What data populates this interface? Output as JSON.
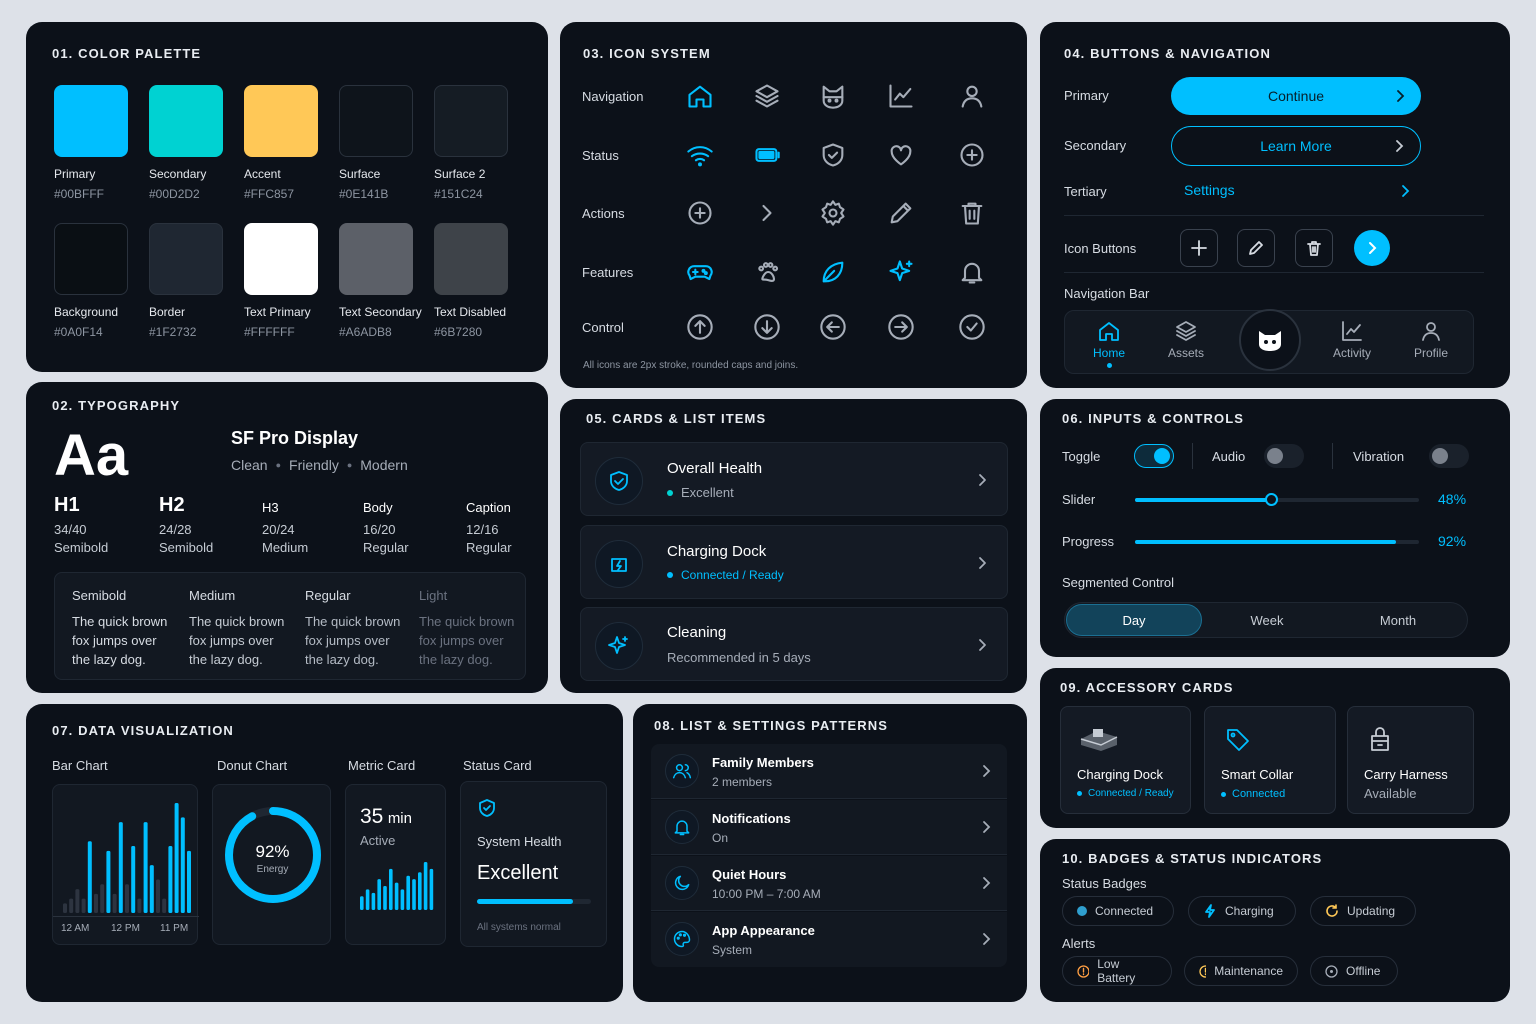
{
  "colors": {
    "primary": "#00BFFF",
    "secondary": "#00D2D2",
    "accent": "#FFC857",
    "surface": "#0E141B",
    "surface2": "#151C24",
    "background": "#0A0F14",
    "border": "#1F2732",
    "text_primary": "#FFFFFF",
    "text_secondary": "#A6ADB8",
    "text_disabled": "#6B7280"
  },
  "palette": {
    "title": "01. COLOR PALETTE",
    "swatches": [
      {
        "name": "Primary",
        "hex": "#00BFFF",
        "color": "#00BFFF"
      },
      {
        "name": "Secondary",
        "hex": "#00D2D2",
        "color": "#00D2D2"
      },
      {
        "name": "Accent",
        "hex": "#FFC857",
        "color": "#FFC857"
      },
      {
        "name": "Surface",
        "hex": "#0E141B",
        "color": "#0E141B"
      },
      {
        "name": "Surface 2",
        "hex": "#151C24",
        "color": "#151C24"
      },
      {
        "name": "Background",
        "hex": "#0A0F14",
        "color": "#0A0F14"
      },
      {
        "name": "Border",
        "hex": "#1F2732",
        "color": "#1F2732"
      },
      {
        "name": "Text Primary",
        "hex": "#FFFFFF",
        "color": "#FFFFFF"
      },
      {
        "name": "Text Secondary",
        "hex": "#A6ADB8",
        "color": "#5C6068"
      },
      {
        "name": "Text Disabled",
        "hex": "#6B7280",
        "color": "#3E4349"
      }
    ]
  },
  "typography": {
    "title": "02. TYPOGRAPHY",
    "sample": "Aa",
    "font_name": "SF Pro Display",
    "traits": [
      "Clean",
      "Friendly",
      "Modern"
    ],
    "scale": [
      {
        "name": "H1",
        "size": "34/40",
        "weight": "Semibold"
      },
      {
        "name": "H2",
        "size": "24/28",
        "weight": "Semibold"
      },
      {
        "name": "H3",
        "size": "20/24",
        "weight": "Medium"
      },
      {
        "name": "Body",
        "size": "16/20",
        "weight": "Regular"
      },
      {
        "name": "Caption",
        "size": "12/16",
        "weight": "Regular"
      }
    ],
    "weights": [
      {
        "name": "Semibold",
        "line1": "The quick brown",
        "line2": "fox jumps over",
        "line3": "the lazy dog."
      },
      {
        "name": "Medium",
        "line1": "The quick brown",
        "line2": "fox jumps over",
        "line3": "the lazy dog."
      },
      {
        "name": "Regular",
        "line1": "The quick brown",
        "line2": "fox jumps over",
        "line3": "the lazy dog."
      },
      {
        "name": "Light",
        "line1": "The quick brown",
        "line2": "fox jumps over",
        "line3": "the lazy dog."
      }
    ]
  },
  "icons": {
    "title": "03. ICON SYSTEM",
    "rows": [
      {
        "label": "Navigation",
        "icons": [
          "home-icon",
          "layers-icon",
          "cat-icon",
          "chart-icon",
          "user-icon"
        ]
      },
      {
        "label": "Status",
        "icons": [
          "wifi-icon",
          "battery-icon",
          "shield-icon",
          "heart-icon",
          "plus-circle-icon"
        ]
      },
      {
        "label": "Actions",
        "icons": [
          "plus-circle-icon",
          "chevron-right-icon",
          "gear-icon",
          "pencil-icon",
          "trash-icon"
        ]
      },
      {
        "label": "Features",
        "icons": [
          "gamepad-icon",
          "paw-icon",
          "leaf-icon",
          "sparkle-icon",
          "bell-icon"
        ]
      },
      {
        "label": "Control",
        "icons": [
          "arrow-up-circle-icon",
          "arrow-down-circle-icon",
          "arrow-left-circle-icon",
          "arrow-right-circle-icon",
          "check-circle-icon"
        ]
      }
    ],
    "note": "All icons are 2px stroke, rounded caps and joins."
  },
  "buttons": {
    "title": "04. BUTTONS & NAVIGATION",
    "primary_label": "Primary",
    "primary_text": "Continue",
    "secondary_label": "Secondary",
    "secondary_text": "Learn More",
    "tertiary_label": "Tertiary",
    "tertiary_text": "Settings",
    "icon_buttons_label": "Icon Buttons",
    "nav_label": "Navigation Bar",
    "nav": [
      "Home",
      "Assets",
      "Activity",
      "Profile"
    ]
  },
  "cards": {
    "title": "05. CARDS & LIST ITEMS",
    "items": [
      {
        "title": "Overall Health",
        "sub": "Excellent"
      },
      {
        "title": "Charging Dock",
        "sub": "Connected / Ready"
      },
      {
        "title": "Cleaning",
        "sub": "Recommended in 5 days"
      }
    ]
  },
  "inputs": {
    "title": "06. INPUTS & CONTROLS",
    "toggle": "Toggle",
    "audio": "Audio",
    "vibration": "Vibration",
    "slider": "Slider",
    "slider_value": "48%",
    "slider_fraction": 0.48,
    "progress": "Progress",
    "progress_value": "92%",
    "progress_fraction": 0.92,
    "segmented": "Segmented Control",
    "segments": [
      "Day",
      "Week",
      "Month"
    ]
  },
  "dataviz": {
    "title": "07. DATA VISUALIZATION",
    "bar_label": "Bar Chart",
    "donut_label": "Donut Chart",
    "metric_label": "Metric Card",
    "status_label": "Status Card",
    "ticks": [
      "12 AM",
      "12 PM",
      "11 PM"
    ],
    "donut_value": "92%",
    "donut_caption": "Energy",
    "metric_value": "35",
    "metric_unit": "min",
    "metric_caption": "Active",
    "status_title": "System Health",
    "status_value": "Excellent",
    "status_note": "All systems normal"
  },
  "chart_data": [
    {
      "type": "bar",
      "title": "Bar Chart",
      "categories": [
        "12 AM",
        "12 PM",
        "11 PM"
      ],
      "values": [
        2,
        3,
        5,
        3,
        15,
        4,
        6,
        13,
        4,
        19,
        6,
        14,
        3,
        19,
        10,
        7,
        3,
        14,
        23,
        20,
        13
      ],
      "accent": [
        false,
        false,
        false,
        false,
        true,
        false,
        false,
        true,
        false,
        true,
        false,
        true,
        false,
        true,
        true,
        false,
        false,
        true,
        true,
        true,
        true
      ]
    },
    {
      "type": "pie",
      "title": "Donut Chart",
      "values": [
        92,
        8
      ],
      "labels": [
        "Energy",
        ""
      ]
    },
    {
      "type": "bar",
      "title": "Metric Card",
      "values": [
        4,
        6,
        5,
        9,
        7,
        12,
        8,
        6,
        10,
        9,
        11,
        14,
        12
      ]
    }
  ],
  "list": {
    "title": "08. LIST & SETTINGS PATTERNS",
    "items": [
      {
        "title": "Family Members",
        "sub": "2 members",
        "icon": "people-icon"
      },
      {
        "title": "Notifications",
        "sub": "On",
        "icon": "bell-icon"
      },
      {
        "title": "Quiet Hours",
        "sub": "10:00 PM – 7:00 AM",
        "icon": "moon-icon"
      },
      {
        "title": "App Appearance",
        "sub": "System",
        "icon": "palette-icon"
      }
    ]
  },
  "accessory": {
    "title": "09. ACCESSORY CARDS",
    "items": [
      {
        "title": "Charging Dock",
        "sub": "Connected / Ready"
      },
      {
        "title": "Smart Collar",
        "sub": "Connected"
      },
      {
        "title": "Carry Harness",
        "sub": "Available"
      }
    ]
  },
  "badges": {
    "title": "10. BADGES & STATUS INDICATORS",
    "status_label": "Status Badges",
    "status": [
      "Connected",
      "Charging",
      "Updating"
    ],
    "alerts_label": "Alerts",
    "alerts": [
      "Low Battery",
      "Maintenance",
      "Offline"
    ]
  }
}
